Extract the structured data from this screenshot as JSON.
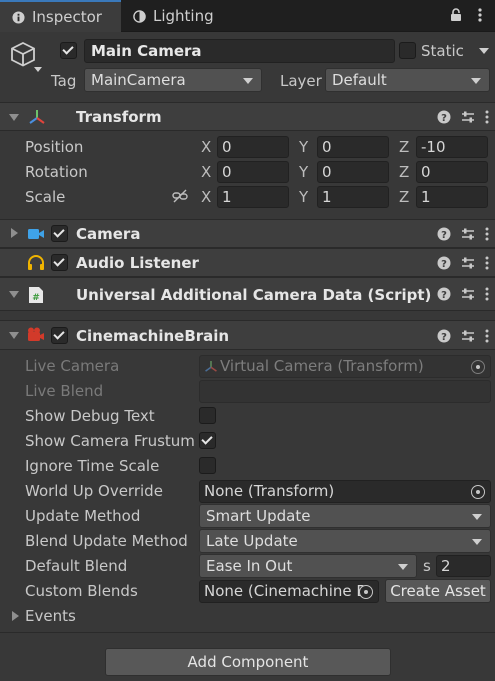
{
  "tabs": [
    {
      "label": "Inspector",
      "icon": "info-icon",
      "active": true
    },
    {
      "label": "Lighting",
      "icon": "lighting-icon",
      "active": false
    }
  ],
  "header": {
    "object_name": "Main Camera",
    "static_label": "Static",
    "tag_label": "Tag",
    "tag_value": "MainCamera",
    "layer_label": "Layer",
    "layer_value": "Default"
  },
  "transform": {
    "title": "Transform",
    "position": {
      "label": "Position",
      "x": "0",
      "y": "0",
      "z": "-10"
    },
    "rotation": {
      "label": "Rotation",
      "x": "0",
      "y": "0",
      "z": "0"
    },
    "scale": {
      "label": "Scale",
      "x": "1",
      "y": "1",
      "z": "1"
    },
    "axes": {
      "x": "X",
      "y": "Y",
      "z": "Z"
    }
  },
  "components": {
    "camera": "Camera",
    "audio_listener": "Audio Listener",
    "urp_data": "Universal Additional Camera Data (Script)",
    "brain": "CinemachineBrain"
  },
  "brain": {
    "live_camera_label": "Live Camera",
    "live_camera_value": "Virtual Camera (Transform)",
    "live_blend_label": "Live Blend",
    "show_debug_text_label": "Show Debug Text",
    "show_debug_text": false,
    "show_camera_frustum_label": "Show Camera Frustum",
    "show_camera_frustum": true,
    "ignore_time_scale_label": "Ignore Time Scale",
    "ignore_time_scale": false,
    "world_up_override_label": "World Up Override",
    "world_up_override_value": "None (Transform)",
    "update_method_label": "Update Method",
    "update_method_value": "Smart Update",
    "blend_update_method_label": "Blend Update Method",
    "blend_update_method_value": "Late Update",
    "default_blend_label": "Default Blend",
    "default_blend_value": "Ease In Out",
    "default_blend_time_unit": "s",
    "default_blend_time": "2",
    "custom_blends_label": "Custom Blends",
    "custom_blends_value": "None (Cinemachine B",
    "create_asset_label": "Create Asset",
    "events_label": "Events"
  },
  "add_component_label": "Add Component",
  "colors": {
    "accent_tab": "#3a79bb",
    "transform_icon": [
      "#e0443c",
      "#6ec36a",
      "#4a8fe0"
    ],
    "camera_icon": "#3fa2e8",
    "audio_icon": "#f0b400",
    "brain_icon": "#d23a2a"
  }
}
